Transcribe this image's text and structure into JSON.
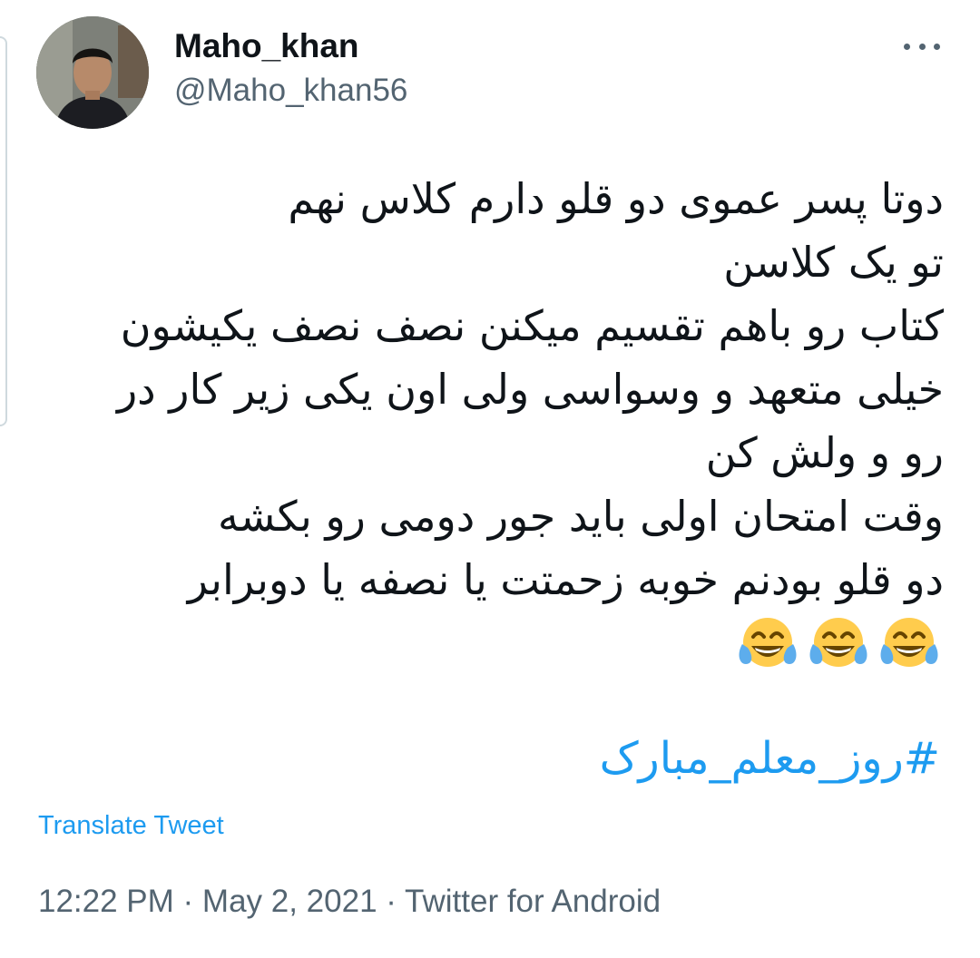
{
  "tweet": {
    "display_name": "Maho_khan",
    "handle": "@Maho_khan56",
    "more_icon": "more-horizontal-icon",
    "lines": [
      "دوتا پسر عموی دو قلو دارم کلاس نهم",
      "تو یک کلاسن",
      "کتاب رو باهم تقسیم میکنن نصف نصف یکیشون",
      "خیلی متعهد و وسواسی ولی اون یکی زیر کار در",
      "رو و ولش کن",
      "وقت امتحان اولی باید جور دومی رو بکشه",
      "دو قلو بودنم خوبه زحمتت یا نصفه یا دوبرابر"
    ],
    "emoji": [
      "😂",
      "😂",
      "😂"
    ],
    "hashtag": "#روز_معلم_مبارک",
    "translate_label": "Translate Tweet",
    "time": "12:22 PM",
    "date": "May 2, 2021",
    "source": "Twitter for Android",
    "separator": " · "
  },
  "colors": {
    "link": "#1d9bf0",
    "text": "#0f1419",
    "secondary": "#536471"
  }
}
